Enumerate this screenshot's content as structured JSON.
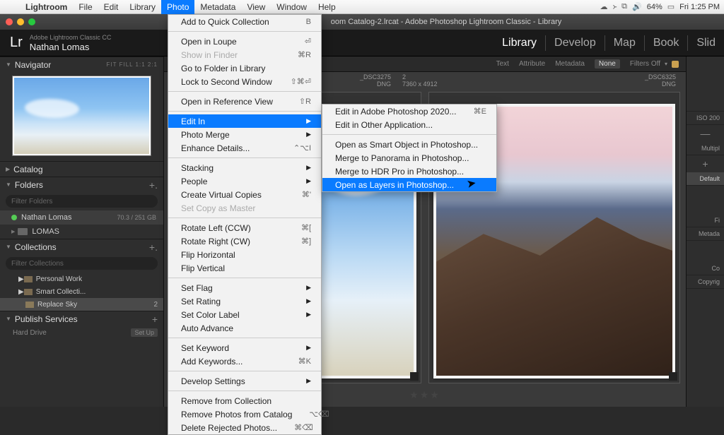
{
  "mac": {
    "app": "Lightroom",
    "items": [
      "File",
      "Edit",
      "Library",
      "Photo",
      "Metadata",
      "View",
      "Window",
      "Help"
    ],
    "active_index": 3,
    "battery": "64%",
    "time": "Fri 1:25 PM"
  },
  "window": {
    "title": "oom Catalog-2.lrcat - Adobe Photoshop Lightroom Classic - Library"
  },
  "identity": {
    "brand": "Adobe Lightroom Classic CC",
    "user": "Nathan Lomas"
  },
  "modules": {
    "items": [
      "Library",
      "Develop",
      "Map",
      "Book",
      "Slid"
    ],
    "active": "Library"
  },
  "navigator": {
    "title": "Navigator",
    "opts": "FIT   FILL   1:1   2:1"
  },
  "panels": {
    "catalog": "Catalog",
    "folders": "Folders",
    "collections": "Collections",
    "publish": "Publish Services",
    "filter_placeholder": "Filter Folders",
    "filter_coll_placeholder": "Filter Collections"
  },
  "folders": [
    {
      "name": "Nathan Lomas",
      "meta": "70.3 / 251 GB",
      "sel": true
    },
    {
      "name": "LOMAS",
      "meta": "",
      "sel": false
    }
  ],
  "collections": [
    {
      "name": "Personal Work",
      "count": "",
      "sel": false
    },
    {
      "name": "Smart Collecti...",
      "count": "",
      "sel": false
    },
    {
      "name": "Replace Sky",
      "count": "2",
      "sel": true
    }
  ],
  "publish_row": {
    "name": "Hard Drive",
    "btn": "Set Up"
  },
  "filterbar": {
    "items": [
      "Text",
      "Attribute",
      "Metadata",
      "None"
    ],
    "active": "None",
    "right": "Filters Off"
  },
  "grid_meta": {
    "left_name": "_DSC3275",
    "left_type": "DNG",
    "mid_num": "2",
    "mid_dim": "7360 x 4912",
    "right_name": "_DSC6325",
    "right_type": "DNG"
  },
  "stars": "★★★",
  "right_strip": {
    "iso": "ISO 200",
    "multi": "Multipl",
    "def": "Default",
    "fi": "Fi",
    "meta": "Metada",
    "co": "Co",
    "copy": "Copyrig"
  },
  "menu1": [
    {
      "t": "Add to Quick Collection",
      "sc": "B"
    },
    {
      "sep": true
    },
    {
      "t": "Open in Loupe",
      "sc": "⏎"
    },
    {
      "t": "Show in Finder",
      "sc": "⌘R",
      "dis": true
    },
    {
      "t": "Go to Folder in Library"
    },
    {
      "t": "Lock to Second Window",
      "sc": "⇧⌘⏎"
    },
    {
      "sep": true
    },
    {
      "t": "Open in Reference View",
      "sc": "⇧R"
    },
    {
      "sep": true
    },
    {
      "t": "Edit In",
      "sub": true,
      "hi": true
    },
    {
      "t": "Photo Merge",
      "sub": true
    },
    {
      "t": "Enhance Details...",
      "sc": "⌃⌥I"
    },
    {
      "sep": true
    },
    {
      "t": "Stacking",
      "sub": true
    },
    {
      "t": "People",
      "sub": true
    },
    {
      "t": "Create Virtual Copies",
      "sc": "⌘'"
    },
    {
      "t": "Set Copy as Master",
      "dis": true
    },
    {
      "sep": true
    },
    {
      "t": "Rotate Left (CCW)",
      "sc": "⌘["
    },
    {
      "t": "Rotate Right (CW)",
      "sc": "⌘]"
    },
    {
      "t": "Flip Horizontal"
    },
    {
      "t": "Flip Vertical"
    },
    {
      "sep": true
    },
    {
      "t": "Set Flag",
      "sub": true
    },
    {
      "t": "Set Rating",
      "sub": true
    },
    {
      "t": "Set Color Label",
      "sub": true
    },
    {
      "t": "Auto Advance"
    },
    {
      "sep": true
    },
    {
      "t": "Set Keyword",
      "sub": true
    },
    {
      "t": "Add Keywords...",
      "sc": "⌘K"
    },
    {
      "sep": true
    },
    {
      "t": "Develop Settings",
      "sub": true
    },
    {
      "sep": true
    },
    {
      "t": "Remove from Collection"
    },
    {
      "t": "Remove Photos from Catalog",
      "sc": "⌥⌫"
    },
    {
      "t": "Delete Rejected Photos...",
      "sc": "⌘⌫"
    }
  ],
  "menu2": [
    {
      "t": "Edit in Adobe Photoshop 2020...",
      "sc": "⌘E"
    },
    {
      "t": "Edit in Other Application..."
    },
    {
      "sep": true
    },
    {
      "t": "Open as Smart Object in Photoshop..."
    },
    {
      "t": "Merge to Panorama in Photoshop..."
    },
    {
      "t": "Merge to HDR Pro in Photoshop..."
    },
    {
      "t": "Open as Layers in Photoshop...",
      "hi": true
    }
  ]
}
